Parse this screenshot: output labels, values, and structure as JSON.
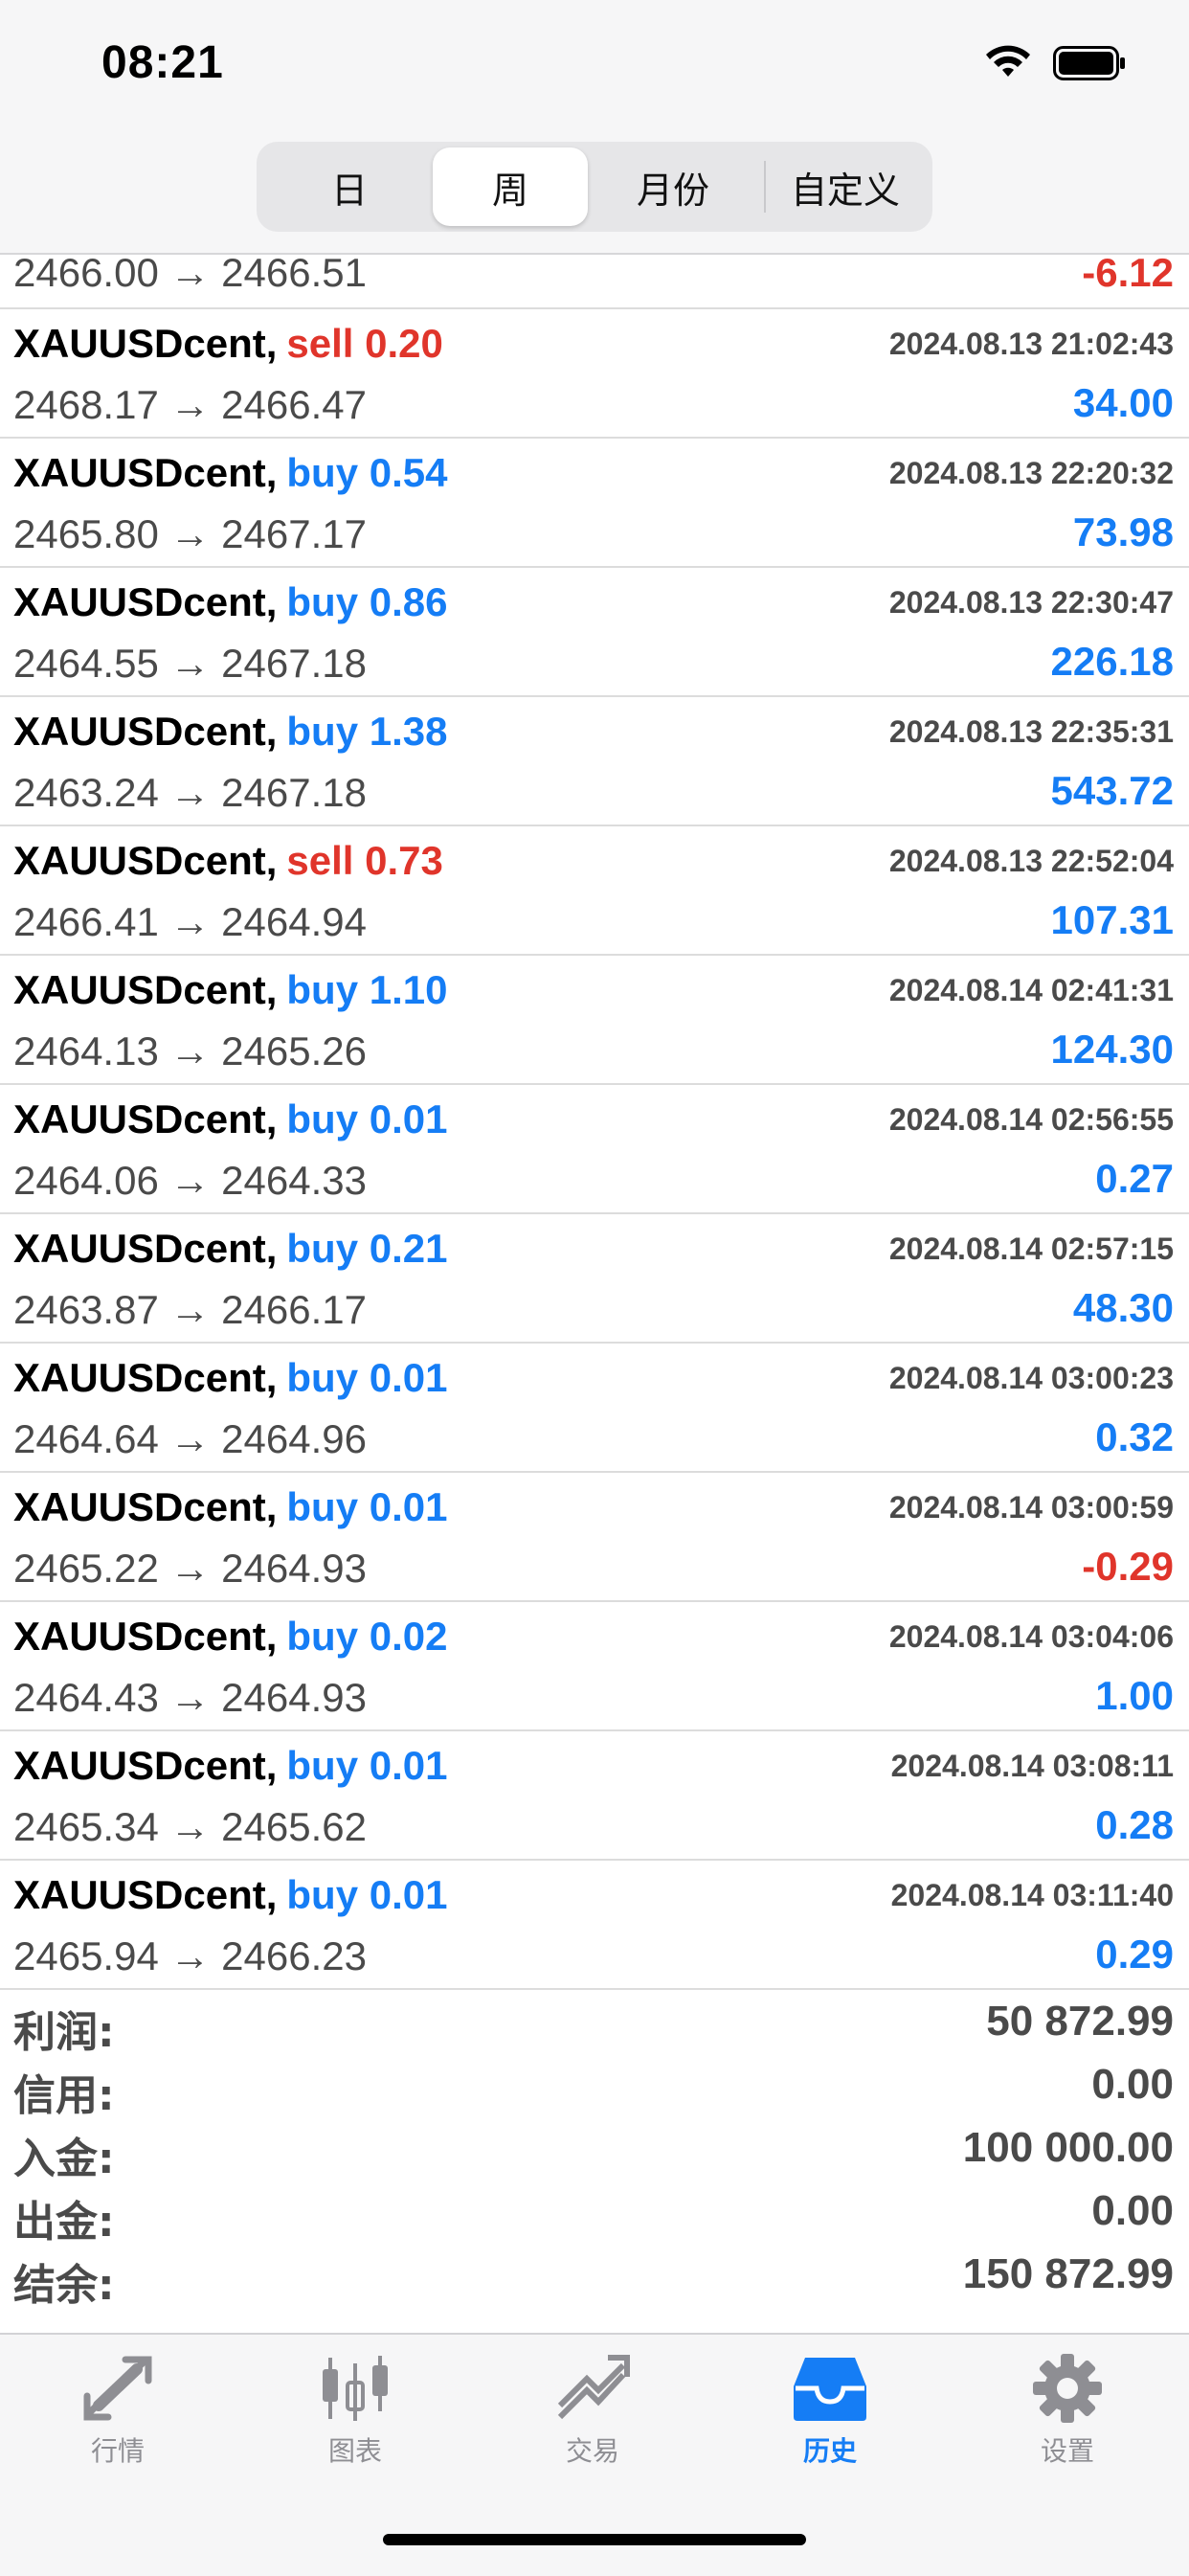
{
  "status_bar": {
    "time": "08:21"
  },
  "segmented": {
    "tabs": [
      "日",
      "周",
      "月份",
      "自定义"
    ],
    "selected": "周"
  },
  "partial_row": {
    "prices": "2466.00 → 2466.51",
    "profit": "-6.12"
  },
  "trades": [
    {
      "symbol": "XAUUSDcent,",
      "side": "sell",
      "volume": "0.20",
      "time": "2024.08.13 21:02:43",
      "prices": "2468.17 → 2466.47",
      "profit": "34.00"
    },
    {
      "symbol": "XAUUSDcent,",
      "side": "buy",
      "volume": "0.54",
      "time": "2024.08.13 22:20:32",
      "prices": "2465.80 → 2467.17",
      "profit": "73.98"
    },
    {
      "symbol": "XAUUSDcent,",
      "side": "buy",
      "volume": "0.86",
      "time": "2024.08.13 22:30:47",
      "prices": "2464.55 → 2467.18",
      "profit": "226.18"
    },
    {
      "symbol": "XAUUSDcent,",
      "side": "buy",
      "volume": "1.38",
      "time": "2024.08.13 22:35:31",
      "prices": "2463.24 → 2467.18",
      "profit": "543.72"
    },
    {
      "symbol": "XAUUSDcent,",
      "side": "sell",
      "volume": "0.73",
      "time": "2024.08.13 22:52:04",
      "prices": "2466.41 → 2464.94",
      "profit": "107.31"
    },
    {
      "symbol": "XAUUSDcent,",
      "side": "buy",
      "volume": "1.10",
      "time": "2024.08.14 02:41:31",
      "prices": "2464.13 → 2465.26",
      "profit": "124.30"
    },
    {
      "symbol": "XAUUSDcent,",
      "side": "buy",
      "volume": "0.01",
      "time": "2024.08.14 02:56:55",
      "prices": "2464.06 → 2464.33",
      "profit": "0.27"
    },
    {
      "symbol": "XAUUSDcent,",
      "side": "buy",
      "volume": "0.21",
      "time": "2024.08.14 02:57:15",
      "prices": "2463.87 → 2466.17",
      "profit": "48.30"
    },
    {
      "symbol": "XAUUSDcent,",
      "side": "buy",
      "volume": "0.01",
      "time": "2024.08.14 03:00:23",
      "prices": "2464.64 → 2464.96",
      "profit": "0.32"
    },
    {
      "symbol": "XAUUSDcent,",
      "side": "buy",
      "volume": "0.01",
      "time": "2024.08.14 03:00:59",
      "prices": "2465.22 → 2464.93",
      "profit": "-0.29"
    },
    {
      "symbol": "XAUUSDcent,",
      "side": "buy",
      "volume": "0.02",
      "time": "2024.08.14 03:04:06",
      "prices": "2464.43 → 2464.93",
      "profit": "1.00"
    },
    {
      "symbol": "XAUUSDcent,",
      "side": "buy",
      "volume": "0.01",
      "time": "2024.08.14 03:08:11",
      "prices": "2465.34 → 2465.62",
      "profit": "0.28"
    },
    {
      "symbol": "XAUUSDcent,",
      "side": "buy",
      "volume": "0.01",
      "time": "2024.08.14 03:11:40",
      "prices": "2465.94 → 2466.23",
      "profit": "0.29"
    }
  ],
  "summary": [
    {
      "label": "利润:",
      "value": "50 872.99"
    },
    {
      "label": "信用:",
      "value": "0.00"
    },
    {
      "label": "入金:",
      "value": "100 000.00"
    },
    {
      "label": "出金:",
      "value": "0.00"
    },
    {
      "label": "结余:",
      "value": "150 872.99"
    }
  ],
  "tabbar": {
    "items": [
      {
        "label": "行情",
        "icon": "quotes-arrows-icon"
      },
      {
        "label": "图表",
        "icon": "candlestick-chart-icon"
      },
      {
        "label": "交易",
        "icon": "trade-trend-icon"
      },
      {
        "label": "历史",
        "icon": "history-inbox-icon"
      },
      {
        "label": "设置",
        "icon": "gear-icon"
      }
    ],
    "active": "历史"
  },
  "colors": {
    "buy": "#157df5",
    "sell": "#e0352b",
    "active_tab": "#157df5",
    "inactive_tab": "#8e8e93"
  }
}
